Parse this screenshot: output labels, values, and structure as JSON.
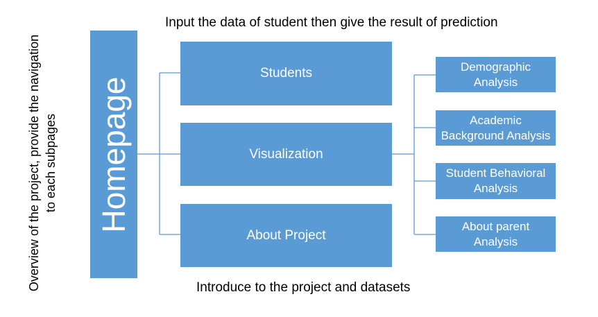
{
  "homepage": {
    "label": "Homepage",
    "description_line1": "Overview of the project, provide the navigation",
    "description_line2": "to each subpages"
  },
  "pages": {
    "students": "Students",
    "visualization": "Visualization",
    "about_project": "About Project"
  },
  "captions": {
    "students_note": "Input the data of student then give the result of prediction",
    "about_note": "Introduce to the project and datasets"
  },
  "analyses": {
    "demographic": [
      "Demographic",
      "Analysis"
    ],
    "academic": [
      "Academic",
      "Background Analysis"
    ],
    "behavioral": [
      "Student Behavioral",
      "Analysis"
    ],
    "parent": [
      "About parent",
      "Analysis"
    ]
  },
  "colors": {
    "box_fill": "#5b9bd5",
    "connector": "#5b9bd5",
    "box_text": "#ffffff"
  }
}
